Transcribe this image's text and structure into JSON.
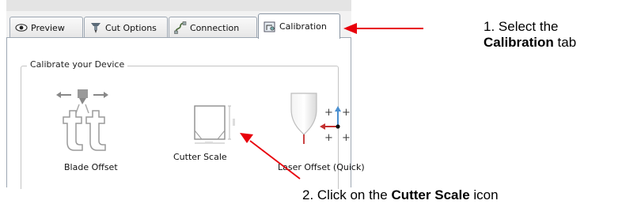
{
  "tabs": [
    {
      "label": "Preview",
      "icon": "eye-icon"
    },
    {
      "label": "Cut Options",
      "icon": "blade-holder-icon"
    },
    {
      "label": "Connection",
      "icon": "cable-connection-icon"
    },
    {
      "label": "Calibration",
      "icon": "calibration-icon",
      "active": true
    }
  ],
  "group": {
    "title": "Calibrate your Device"
  },
  "calibration_items": [
    {
      "label": "Blade Offset",
      "icon": "blade-offset-icon"
    },
    {
      "label": "Cutter Scale",
      "icon": "cutter-scale-icon"
    },
    {
      "label": "Laser Offset (Quick)",
      "icon": "laser-offset-icon"
    }
  ],
  "annotations": {
    "step1": {
      "prefix": "1. Select  the",
      "bold": "Calibration",
      "suffix": " tab"
    },
    "step2": {
      "prefix": "2. Click on the ",
      "bold": "Cutter Scale",
      "suffix": " icon"
    },
    "arrow_color": "#e8000b"
  }
}
